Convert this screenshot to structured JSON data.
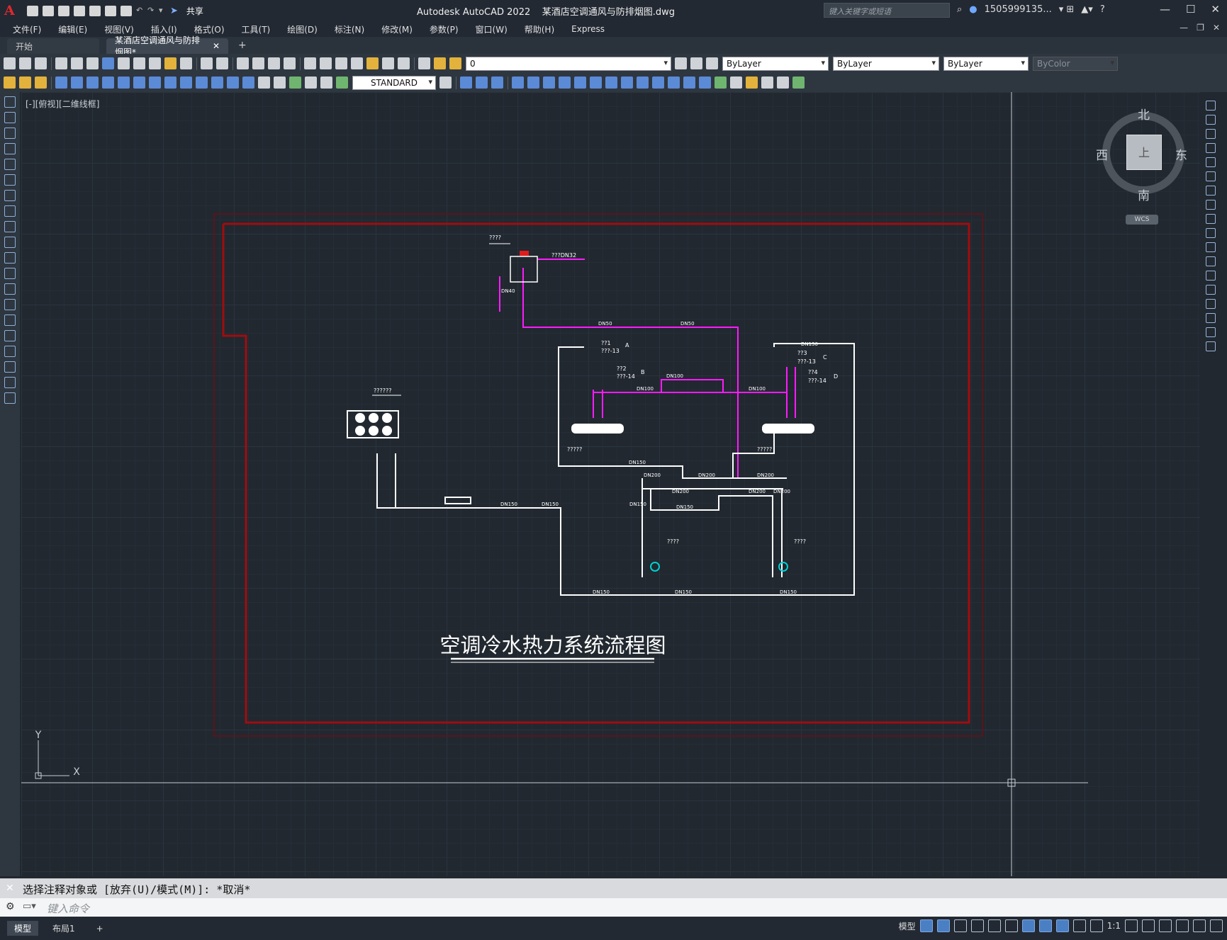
{
  "titlebar": {
    "app_title": "Autodesk AutoCAD 2022",
    "doc_title": "某酒店空调通风与防排烟图.dwg",
    "share": "共享",
    "search_placeholder": "键入关键字或短语",
    "user": "1505999135...",
    "help": "?"
  },
  "menu": [
    "文件(F)",
    "编辑(E)",
    "视图(V)",
    "插入(I)",
    "格式(O)",
    "工具(T)",
    "绘图(D)",
    "标注(N)",
    "修改(M)",
    "参数(P)",
    "窗口(W)",
    "帮助(H)",
    "Express"
  ],
  "tabs": [
    {
      "label": "开始"
    },
    {
      "label": "某酒店空调通风与防排烟图*"
    }
  ],
  "toolbar": {
    "layer": "0",
    "color": "ByLayer",
    "linetype": "ByLayer",
    "lineweight": "ByLayer",
    "plotstyle": "ByColor",
    "textstyle": "STANDARD"
  },
  "viewport": {
    "label": "[-][俯视][二维线框]",
    "compass": {
      "north": "北",
      "south": "南",
      "east": "东",
      "west": "西",
      "top": "上"
    },
    "wcs": "WCS",
    "ucs_x": "X",
    "ucs_y": "Y"
  },
  "drawing": {
    "title": "空调冷水热力系统流程图",
    "labels": {
      "tank": "????",
      "tank_pipe": "???DN32",
      "cooling_tower": "??????",
      "unit_left": "?????",
      "unit_right": "?????",
      "pump_left": "????",
      "pump_right": "????",
      "a1": "??1",
      "a2": "???-13",
      "b1": "??2",
      "b2": "???-14",
      "c1": "??3",
      "c2": "???-13",
      "d1": "??4",
      "d2": "???-14",
      "circle_a": "A",
      "circle_b": "B",
      "circle_c": "C",
      "circle_d": "D"
    },
    "pipe_sizes": {
      "dn40": "DN40",
      "dn50": "DN50",
      "dn100": "DN100",
      "dn150": "DN150",
      "dn200": "DN200"
    }
  },
  "command": {
    "history": "选择注释对象或 [放弃(U)/模式(M)]: *取消*",
    "prompt": "键入命令"
  },
  "status": {
    "layout_tabs": [
      "模型",
      "布局1"
    ],
    "model": "模型",
    "scale": "1:1"
  },
  "colors": {
    "pipe_white": "#ffffff",
    "pipe_magenta": "#ff1aff",
    "frame_red": "#8b0000",
    "accent_cyan": "#00d0d0"
  }
}
